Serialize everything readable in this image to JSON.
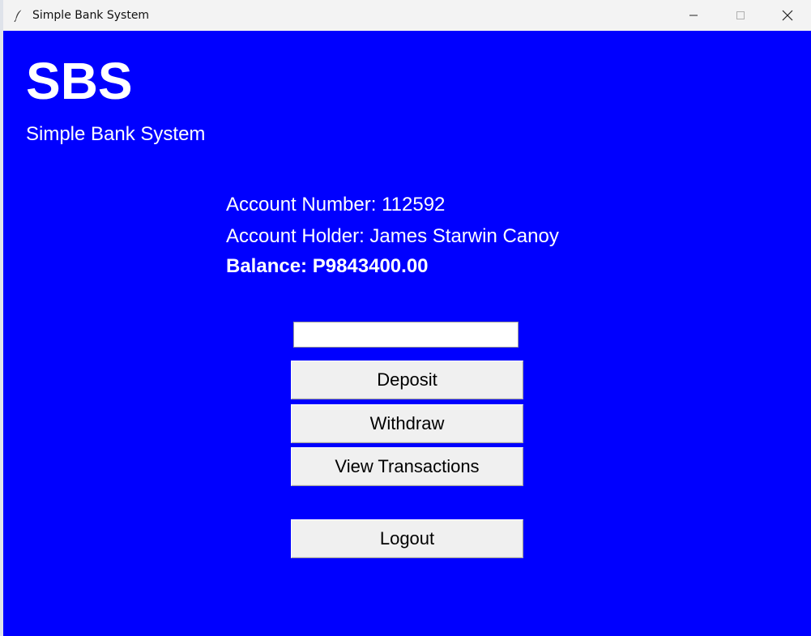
{
  "window": {
    "title": "Simple Bank System",
    "icon": "feather-icon",
    "controls": [
      "minimize-icon",
      "maximize-icon",
      "close-icon"
    ]
  },
  "header": {
    "logo": "SBS",
    "subtitle": "Simple Bank System"
  },
  "account": {
    "number_line": "Account Number: 112592",
    "holder_line": "Account Holder: James Starwin Canoy",
    "balance_line": "Balance: P9843400.00"
  },
  "amount_input": {
    "value": "",
    "placeholder": ""
  },
  "buttons": {
    "deposit": "Deposit",
    "withdraw": "Withdraw",
    "view_transactions": "View Transactions",
    "logout": "Logout"
  },
  "colors": {
    "background": "#0000ff",
    "text": "#ffffff",
    "button_face": "#f0f0f0"
  }
}
